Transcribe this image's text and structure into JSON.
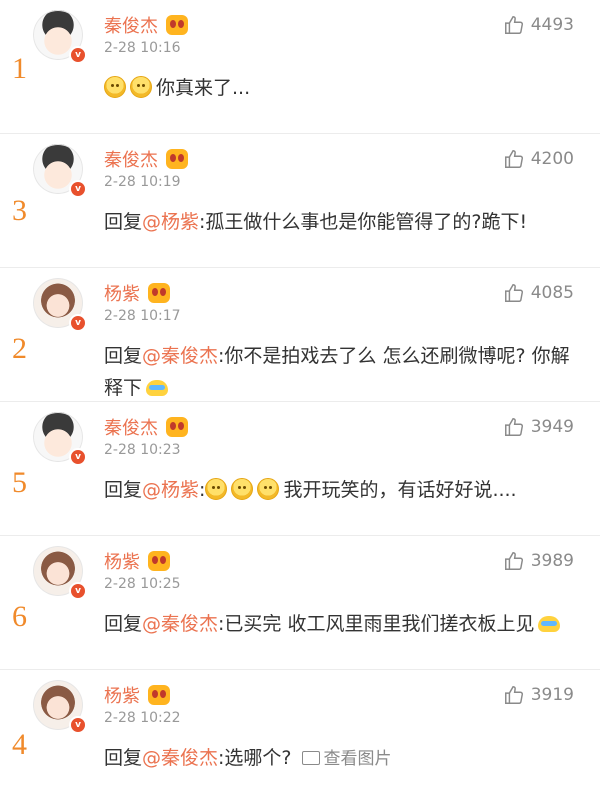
{
  "comments": [
    {
      "rank": "1",
      "name": "秦俊杰",
      "time": "2-28 10:16",
      "likes": "4493",
      "avatar": "avatar-qin",
      "reply_prefix": "",
      "reply_mention": "",
      "text": "你真来了...",
      "emoji_before": 2
    },
    {
      "rank": "3",
      "name": "秦俊杰",
      "time": "2-28 10:19",
      "likes": "4200",
      "avatar": "avatar-qin",
      "reply_prefix": "回复",
      "reply_mention": "@杨紫",
      "text": ":孤王做什么事也是你能管得了的?跪下!"
    },
    {
      "rank": "2",
      "name": "杨紫",
      "time": "2-28 10:17",
      "likes": "4085",
      "avatar": "avatar-yang",
      "reply_prefix": "回复",
      "reply_mention": "@秦俊杰",
      "text": ":你不是拍戏去了么 怎么还刷微博呢? 你解释下"
    },
    {
      "rank": "5",
      "name": "秦俊杰",
      "time": "2-28 10:23",
      "likes": "3949",
      "avatar": "avatar-qin",
      "reply_prefix": "回复",
      "reply_mention": "@杨紫",
      "text": "我开玩笑的，有话好好说....",
      "emoji_before": 3
    },
    {
      "rank": "6",
      "name": "杨紫",
      "time": "2-28 10:25",
      "likes": "3989",
      "avatar": "avatar-yang",
      "reply_prefix": "回复",
      "reply_mention": "@秦俊杰",
      "text": ":已买完 收工风里雨里我们搓衣板上见"
    },
    {
      "rank": "4",
      "name": "杨紫",
      "time": "2-28 10:22",
      "likes": "3919",
      "avatar": "avatar-yang",
      "reply_prefix": "回复",
      "reply_mention": "@秦俊杰",
      "text": ":选哪个?",
      "pic_link": "查看图片"
    }
  ],
  "colors": {
    "name": "#eb7350",
    "rank": "#f08a2b",
    "meta": "#999999"
  },
  "icons": {
    "like": "thumbs-up-icon",
    "verified": "verified-badge-icon",
    "vip": "vip-crown-icon",
    "picture": "picture-icon"
  }
}
